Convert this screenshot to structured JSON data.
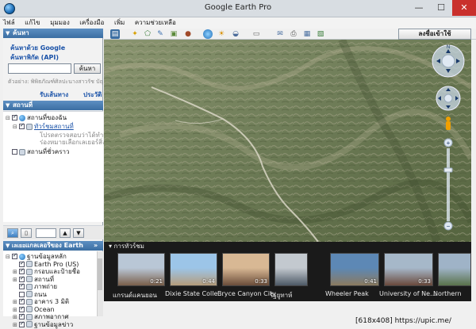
{
  "window": {
    "title": "Google Earth Pro",
    "minimize": "—",
    "maximize": "☐",
    "close": "✕"
  },
  "menu": [
    "ไฟล์",
    "แก้ไข",
    "มุมมอง",
    "เครื่องมือ",
    "เพิ่ม",
    "ความช่วยเหลือ"
  ],
  "toolbar": {
    "signin_label": "ลงชื่อเข้าใช้"
  },
  "search": {
    "header": "ค้นหา",
    "tab_google": "ค้นหาด้วย Google",
    "tab_api": "ค้นหาพิกัด (API)",
    "input_value": "",
    "button_label": "ค้นหา",
    "example": "ตัวอย่าง: พิพิธภัณฑ์ศิลปะนางสาวรัช บัญชา",
    "link_directions": "รับเส้นทาง",
    "link_history": "ประวัติ"
  },
  "places": {
    "header": "สถานที่",
    "items": [
      {
        "label": "สถานที่ของฉัน",
        "expander": "⊟",
        "checked": true
      },
      {
        "label": "ทัวร์ชมสถานที่",
        "expander": "⊟",
        "checked": true
      },
      {
        "label": "โปรดตรวจสอบว่าได้ทำเครื่องหมาย"
      },
      {
        "label": "ร่องหมายเลือกเลเยอร์สิ่งก่อสร้าง"
      },
      {
        "label": "สถานที่ชั่วคราว",
        "expander": "",
        "checked": false
      }
    ]
  },
  "layers": {
    "header_left": "▼ เลเยอ",
    "header": "แกลเลอรีของ Earth",
    "header_chevron": "»",
    "items": [
      {
        "label": "ฐานข้อมูลหลัก",
        "expander": "⊟",
        "checked": true
      },
      {
        "label": "Earth Pro (US)",
        "expander": "",
        "checked": true
      },
      {
        "label": "กรอบและป้ายชื่อ",
        "expander": "⊞",
        "checked": true
      },
      {
        "label": "สถานที่",
        "expander": "⊞",
        "checked": true
      },
      {
        "label": "ภาพถ่าย",
        "expander": "",
        "checked": true
      },
      {
        "label": "ถนน",
        "expander": "",
        "checked": false
      },
      {
        "label": "อาคาร 3 มิติ",
        "expander": "⊞",
        "checked": true
      },
      {
        "label": "Ocean",
        "expander": "⊞",
        "checked": true
      },
      {
        "label": "สภาพอากาศ",
        "expander": "⊞",
        "checked": true
      },
      {
        "label": "ฐานข้อมูลข่าว",
        "expander": "⊞",
        "checked": true
      }
    ]
  },
  "tours": {
    "header": "▾ การทัวร์ชม",
    "items": [
      {
        "label": "แกรนด์แคนยอน",
        "duration": "0:21",
        "color_a": "#b9c7d6",
        "color_b": "#7a5f4a"
      },
      {
        "label": "Dixie State Colle...",
        "duration": "0:44",
        "color_a": "#9cc5e8",
        "color_b": "#b59c7b"
      },
      {
        "label": "Bryce Canyon City",
        "duration": "0:33",
        "color_a": "#d8b894",
        "color_b": "#6b4d3a"
      },
      {
        "label": "รัฐยูทาห์",
        "duration": "",
        "color_a": "#c3c9cf",
        "color_b": "#4d5966"
      },
      {
        "label": "Wheeler Peak",
        "duration": "0:41",
        "color_a": "#5d88b5",
        "color_b": "#8b7a5e"
      },
      {
        "label": "University of Ne...",
        "duration": "0:33",
        "color_a": "#a6b8c9",
        "color_b": "#6a4a3c"
      },
      {
        "label": "Northern",
        "duration": "",
        "color_a": "#9fb3c7",
        "color_b": "#59724b"
      }
    ]
  },
  "watermark": "[618x408] https://upic.me/"
}
